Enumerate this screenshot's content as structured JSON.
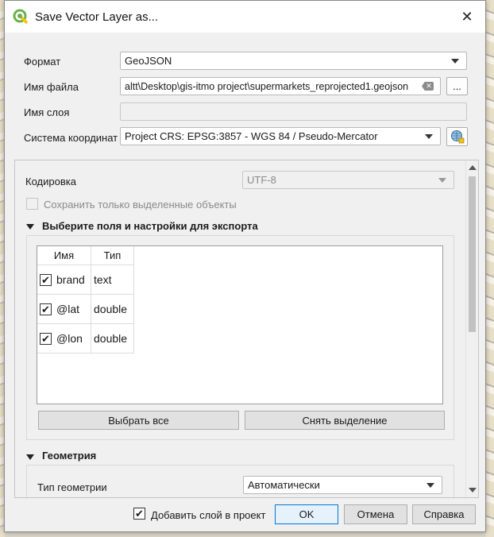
{
  "window": {
    "title": "Save Vector Layer as...",
    "close_glyph": "✕",
    "icon": "qgis-icon"
  },
  "form": {
    "format": {
      "label": "Формат",
      "value": "GeoJSON"
    },
    "filename": {
      "label": "Имя файла",
      "value": "altt\\Desktop\\gis-itmo project\\supermarkets_reprojected1.geojson",
      "browse_label": "...",
      "clear_glyph": "✕"
    },
    "layer_name": {
      "label": "Имя слоя",
      "value": ""
    },
    "crs": {
      "label": "Система координат",
      "value": "Project CRS: EPSG:3857 - WGS 84 / Pseudo-Mercator",
      "button_icon": "crs-globe-icon"
    }
  },
  "options": {
    "encoding": {
      "label": "Кодировка",
      "value": "UTF-8"
    },
    "selected_only": {
      "label": "Сохранить только выделенные объекты",
      "checked": false
    },
    "fields_section": {
      "title": "Выберите поля и настройки для экспорта",
      "columns": [
        "Имя",
        "Тип"
      ],
      "rows": [
        {
          "checked": true,
          "name": "brand",
          "type": "text"
        },
        {
          "checked": true,
          "name": "@lat",
          "type": "double"
        },
        {
          "checked": true,
          "name": "@lon",
          "type": "double"
        }
      ],
      "select_all_label": "Выбрать все",
      "deselect_label": "Снять выделение"
    },
    "geometry_section": {
      "title": "Геометрия",
      "type_label": "Тип геометрии",
      "type_value": "Автоматически"
    }
  },
  "footer": {
    "add_to_project": {
      "label": "Добавить слой в проект",
      "checked": true
    },
    "ok_label": "OK",
    "cancel_label": "Отмена",
    "help_label": "Справка"
  },
  "check_glyph": "✔"
}
